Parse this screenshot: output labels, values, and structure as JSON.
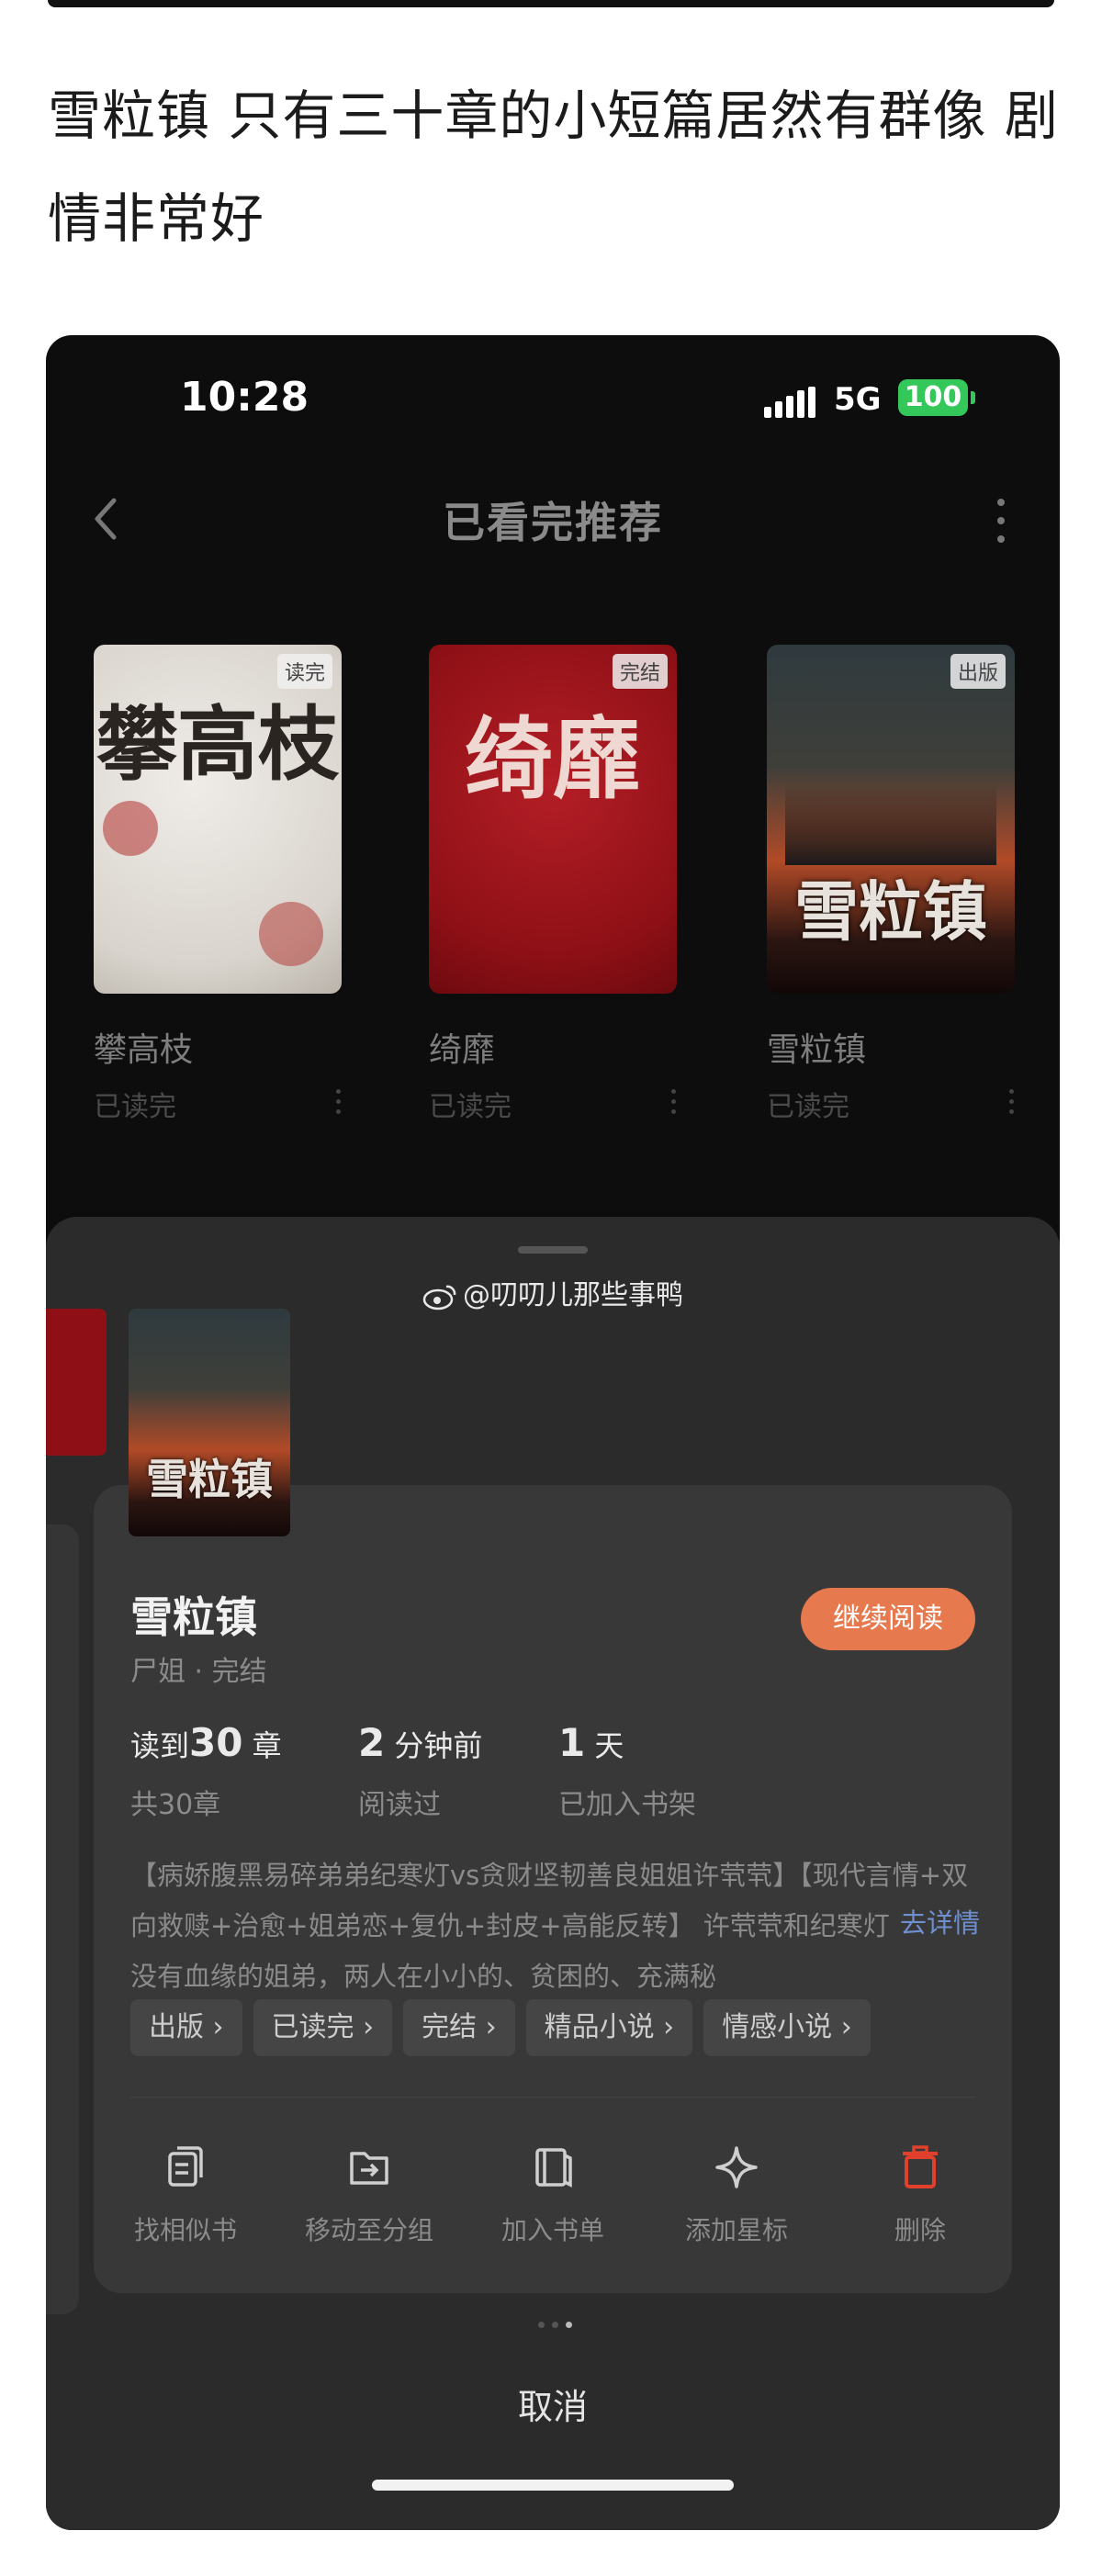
{
  "post": {
    "text": "雪粒镇 只有三十章的小短篇居然有群像 剧情非常好"
  },
  "status_bar": {
    "time": "10:28",
    "network": "5G",
    "battery": "100",
    "battery_color": "#34c759"
  },
  "header": {
    "title": "已看完推荐"
  },
  "books": [
    {
      "title": "攀高枝",
      "status": "已读完",
      "badge": "读完",
      "cover_text": "攀高枝"
    },
    {
      "title": "绮靡",
      "status": "已读完",
      "badge": "完结",
      "cover_text": "绮靡"
    },
    {
      "title": "雪粒镇",
      "status": "已读完",
      "badge": "出版",
      "cover_text": "雪粒镇"
    }
  ],
  "sheet": {
    "watermark": "@叨叨儿那些事鸭",
    "title": "雪粒镇",
    "author": "尸姐 · 完结",
    "continue_label": "继续阅读",
    "accent_color": "#e7794e",
    "stats": [
      {
        "pre": "读到",
        "value": "30",
        "post": "章",
        "sub": "共30章"
      },
      {
        "pre": "",
        "value": "2",
        "post": "分钟前",
        "sub": "阅读过"
      },
      {
        "pre": "",
        "value": "1",
        "post": "天",
        "sub": "已加入书架"
      }
    ],
    "description": "【病娇腹黑易碎弟弟纪寒灯vs贪财坚韧善良姐姐许茕茕】【现代言情+双向救赎+治愈+姐弟恋+复仇+封皮+高能反转】 许茕茕和纪寒灯是一对没有血缘的姐弟，两人在小小的、贫困的、充满秘",
    "desc_more": "去详情",
    "tags": [
      "出版 ›",
      "已读完 ›",
      "完结 ›",
      "精品小说 ›",
      "情感小说 ›"
    ],
    "actions": [
      {
        "label": "找相似书",
        "icon": "similar-book-icon"
      },
      {
        "label": "移动至分组",
        "icon": "move-folder-icon"
      },
      {
        "label": "加入书单",
        "icon": "booklist-icon"
      },
      {
        "label": "添加星标",
        "icon": "star-icon"
      },
      {
        "label": "删除",
        "icon": "trash-icon",
        "color": "#e0402c"
      }
    ],
    "cancel_label": "取消"
  }
}
